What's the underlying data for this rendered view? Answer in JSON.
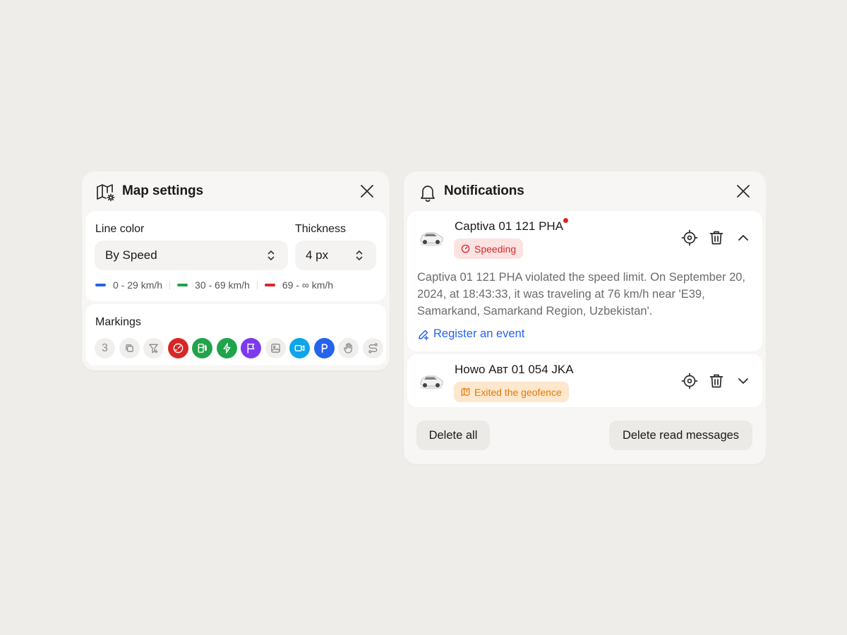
{
  "map_settings": {
    "title": "Map settings",
    "line_color_label": "Line color",
    "line_color_value": "By Speed",
    "thickness_label": "Thickness",
    "thickness_value": "4 px",
    "legend": [
      {
        "label": "0 - 29 km/h",
        "color": "#2563eb"
      },
      {
        "label": "30 - 69 km/h",
        "color": "#20a34a"
      },
      {
        "label": "69 - ∞ km/h",
        "color": "#d92626"
      }
    ],
    "markings_label": "Markings",
    "markings_count": "3",
    "markings": [
      "layers-icon",
      "filter-icon",
      "speedometer-icon",
      "fuel-icon",
      "lightning-icon",
      "flag-icon",
      "image-icon",
      "video-icon",
      "parking-icon",
      "hand-icon",
      "route-icon"
    ]
  },
  "notifications": {
    "title": "Notifications",
    "items": [
      {
        "title": "Captiva 01 121 PHA",
        "badge": "Speeding",
        "badge_color": "#d12a2a",
        "unread": true,
        "expanded": true,
        "body": "Captiva 01 121 PHA violated the speed limit. On September 20, 2024, at 18:43:33, it was traveling at 76 km/h near 'E39, Samarkand, Samarkand Region, Uzbekistan'.",
        "action": "Register an event"
      },
      {
        "title": "Howo Авт 01 054 JKA",
        "badge": "Exited the geofence",
        "badge_color": "#e2790b",
        "unread": false,
        "expanded": false
      }
    ],
    "delete_all": "Delete all",
    "delete_read": "Delete read messages"
  }
}
